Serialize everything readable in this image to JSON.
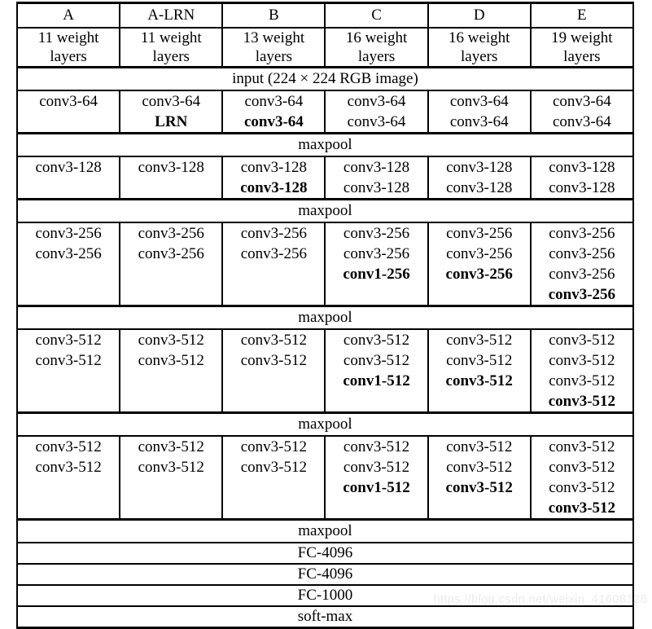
{
  "table": {
    "caption_absent": true,
    "columns": [
      {
        "name": "A",
        "depth_line1": "11 weight",
        "depth_line2": "layers"
      },
      {
        "name": "A-LRN",
        "depth_line1": "11 weight",
        "depth_line2": "layers"
      },
      {
        "name": "B",
        "depth_line1": "13 weight",
        "depth_line2": "layers"
      },
      {
        "name": "C",
        "depth_line1": "16 weight",
        "depth_line2": "layers"
      },
      {
        "name": "D",
        "depth_line1": "16 weight",
        "depth_line2": "layers"
      },
      {
        "name": "E",
        "depth_line1": "19 weight",
        "depth_line2": "layers"
      }
    ],
    "input_row": "input (224 × 224 RGB image)",
    "maxpool_label": "maxpool",
    "blocks": [
      {
        "id": "block-64",
        "cells": [
          {
            "layers": [
              {
                "text": "conv3-64",
                "bold": false
              }
            ]
          },
          {
            "layers": [
              {
                "text": "conv3-64",
                "bold": false
              },
              {
                "text": "LRN",
                "bold": true
              }
            ]
          },
          {
            "layers": [
              {
                "text": "conv3-64",
                "bold": false
              },
              {
                "text": "conv3-64",
                "bold": true
              }
            ]
          },
          {
            "layers": [
              {
                "text": "conv3-64",
                "bold": false
              },
              {
                "text": "conv3-64",
                "bold": false
              }
            ]
          },
          {
            "layers": [
              {
                "text": "conv3-64",
                "bold": false
              },
              {
                "text": "conv3-64",
                "bold": false
              }
            ]
          },
          {
            "layers": [
              {
                "text": "conv3-64",
                "bold": false
              },
              {
                "text": "conv3-64",
                "bold": false
              }
            ]
          }
        ]
      },
      {
        "id": "block-128",
        "cells": [
          {
            "layers": [
              {
                "text": "conv3-128",
                "bold": false
              }
            ]
          },
          {
            "layers": [
              {
                "text": "conv3-128",
                "bold": false
              }
            ]
          },
          {
            "layers": [
              {
                "text": "conv3-128",
                "bold": false
              },
              {
                "text": "conv3-128",
                "bold": true
              }
            ]
          },
          {
            "layers": [
              {
                "text": "conv3-128",
                "bold": false
              },
              {
                "text": "conv3-128",
                "bold": false
              }
            ]
          },
          {
            "layers": [
              {
                "text": "conv3-128",
                "bold": false
              },
              {
                "text": "conv3-128",
                "bold": false
              }
            ]
          },
          {
            "layers": [
              {
                "text": "conv3-128",
                "bold": false
              },
              {
                "text": "conv3-128",
                "bold": false
              }
            ]
          }
        ]
      },
      {
        "id": "block-256",
        "cells": [
          {
            "layers": [
              {
                "text": "conv3-256",
                "bold": false
              },
              {
                "text": "conv3-256",
                "bold": false
              }
            ]
          },
          {
            "layers": [
              {
                "text": "conv3-256",
                "bold": false
              },
              {
                "text": "conv3-256",
                "bold": false
              }
            ]
          },
          {
            "layers": [
              {
                "text": "conv3-256",
                "bold": false
              },
              {
                "text": "conv3-256",
                "bold": false
              }
            ]
          },
          {
            "layers": [
              {
                "text": "conv3-256",
                "bold": false
              },
              {
                "text": "conv3-256",
                "bold": false
              },
              {
                "text": "conv1-256",
                "bold": true
              }
            ]
          },
          {
            "layers": [
              {
                "text": "conv3-256",
                "bold": false
              },
              {
                "text": "conv3-256",
                "bold": false
              },
              {
                "text": "conv3-256",
                "bold": true
              }
            ]
          },
          {
            "layers": [
              {
                "text": "conv3-256",
                "bold": false
              },
              {
                "text": "conv3-256",
                "bold": false
              },
              {
                "text": "conv3-256",
                "bold": false
              },
              {
                "text": "conv3-256",
                "bold": true
              }
            ]
          }
        ]
      },
      {
        "id": "block-512a",
        "cells": [
          {
            "layers": [
              {
                "text": "conv3-512",
                "bold": false
              },
              {
                "text": "conv3-512",
                "bold": false
              }
            ]
          },
          {
            "layers": [
              {
                "text": "conv3-512",
                "bold": false
              },
              {
                "text": "conv3-512",
                "bold": false
              }
            ]
          },
          {
            "layers": [
              {
                "text": "conv3-512",
                "bold": false
              },
              {
                "text": "conv3-512",
                "bold": false
              }
            ]
          },
          {
            "layers": [
              {
                "text": "conv3-512",
                "bold": false
              },
              {
                "text": "conv3-512",
                "bold": false
              },
              {
                "text": "conv1-512",
                "bold": true
              }
            ]
          },
          {
            "layers": [
              {
                "text": "conv3-512",
                "bold": false
              },
              {
                "text": "conv3-512",
                "bold": false
              },
              {
                "text": "conv3-512",
                "bold": true
              }
            ]
          },
          {
            "layers": [
              {
                "text": "conv3-512",
                "bold": false
              },
              {
                "text": "conv3-512",
                "bold": false
              },
              {
                "text": "conv3-512",
                "bold": false
              },
              {
                "text": "conv3-512",
                "bold": true
              }
            ]
          }
        ]
      },
      {
        "id": "block-512b",
        "cells": [
          {
            "layers": [
              {
                "text": "conv3-512",
                "bold": false
              },
              {
                "text": "conv3-512",
                "bold": false
              }
            ]
          },
          {
            "layers": [
              {
                "text": "conv3-512",
                "bold": false
              },
              {
                "text": "conv3-512",
                "bold": false
              }
            ]
          },
          {
            "layers": [
              {
                "text": "conv3-512",
                "bold": false
              },
              {
                "text": "conv3-512",
                "bold": false
              }
            ]
          },
          {
            "layers": [
              {
                "text": "conv3-512",
                "bold": false
              },
              {
                "text": "conv3-512",
                "bold": false
              },
              {
                "text": "conv1-512",
                "bold": true
              }
            ]
          },
          {
            "layers": [
              {
                "text": "conv3-512",
                "bold": false
              },
              {
                "text": "conv3-512",
                "bold": false
              },
              {
                "text": "conv3-512",
                "bold": true
              }
            ]
          },
          {
            "layers": [
              {
                "text": "conv3-512",
                "bold": false
              },
              {
                "text": "conv3-512",
                "bold": false
              },
              {
                "text": "conv3-512",
                "bold": false
              },
              {
                "text": "conv3-512",
                "bold": true
              }
            ]
          }
        ]
      }
    ],
    "footer_rows": [
      "maxpool",
      "FC-4096",
      "FC-4096",
      "FC-1000",
      "soft-max"
    ]
  },
  "watermark": "https://blog.csdn.net/weixin_41608328"
}
